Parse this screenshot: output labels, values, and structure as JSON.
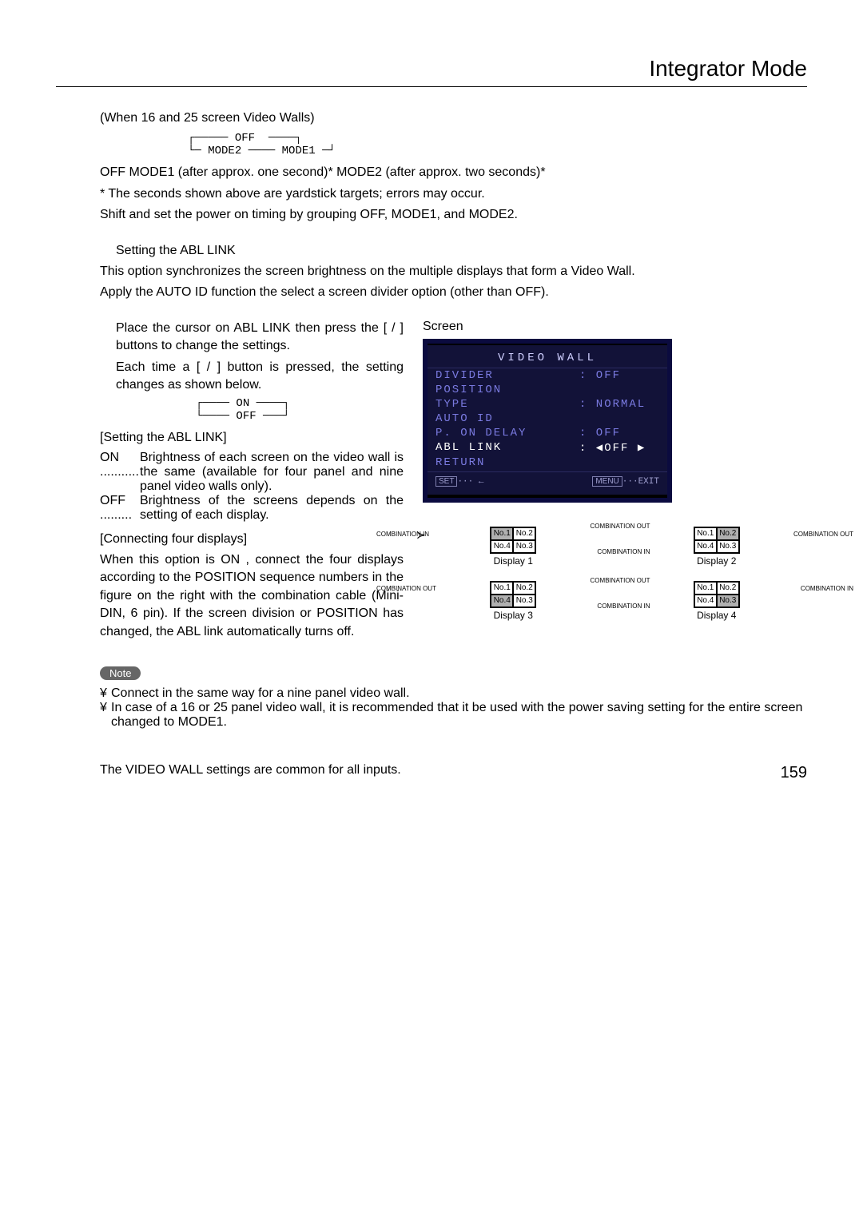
{
  "header": {
    "title": "Integrator Mode"
  },
  "intro": {
    "when_line": "(When 16 and 25 screen Video Walls)",
    "cycle_top": "OFF",
    "cycle_left": "MODE2",
    "cycle_right": "MODE1",
    "sequence": "OFF    MODE1 (after approx. one second)*    MODE2 (after approx. two seconds)*",
    "asterisk": "* The seconds shown above are yardstick targets; errors may occur.",
    "shift": "Shift and set the power on timing by grouping OFF, MODE1, and MODE2."
  },
  "abl": {
    "heading": "Setting the ABL LINK",
    "desc1": "This option synchronizes the screen brightness on the multiple displays that form a Video Wall.",
    "desc2": "Apply the AUTO ID function the select a screen divider option (other than OFF).",
    "step1": "Place the cursor on  ABL LINK  then press the [   /   ] buttons to change the settings.",
    "step2": "Each time a [    /   ] button is pressed, the setting changes as shown below.",
    "cycle_on": "ON",
    "cycle_off": "OFF",
    "setting_heading": "[Setting the ABL LINK]",
    "on_label": "ON ...........",
    "on_text": "Brightness of each screen on the video wall is the same (available for four panel and nine panel video walls only).",
    "off_label": "OFF .........",
    "off_text": "Brightness of the screens depends on the setting of each display.",
    "connect_heading": "[Connecting four displays]",
    "connect_text": "When this option is  ON , connect the four displays according to the POSITION sequence numbers in the figure on the right with the combination cable (Mini-DIN, 6 pin). If the screen division or POSITION has changed, the ABL link automatically turns off."
  },
  "screen": {
    "label": "Screen",
    "title": "VIDEO WALL",
    "rows": [
      {
        "lbl": "DIVIDER",
        "val": ":   OFF",
        "active": false
      },
      {
        "lbl": "POSITION",
        "val": "",
        "active": false
      },
      {
        "lbl": "TYPE",
        "val": ":   NORMAL",
        "active": false
      },
      {
        "lbl": "AUTO ID",
        "val": "",
        "active": false
      },
      {
        "lbl": "P. ON DELAY",
        "val": ":   OFF",
        "active": false
      },
      {
        "lbl": "ABL LINK",
        "val": ": ◀OFF ▶",
        "active": true
      },
      {
        "lbl": "RETURN",
        "val": "",
        "active": false
      }
    ],
    "bottom_left_tag": "SET",
    "bottom_left": "··· ←",
    "bottom_right_tag": "MENU",
    "bottom_right": "···EXIT"
  },
  "diagram": {
    "cells": [
      "No.1",
      "No.2",
      "No.4",
      "No.3"
    ],
    "displays": [
      {
        "label": "Display 1",
        "highlight": 0
      },
      {
        "label": "Display 2",
        "highlight": 1
      },
      {
        "label": "Display 3",
        "highlight": 2
      },
      {
        "label": "Display 4",
        "highlight": 3
      }
    ],
    "comb_in": "COMBINATION\nIN",
    "comb_out": "COMBINATION\nOUT"
  },
  "note": {
    "badge": "Note",
    "bullet_sym": "¥",
    "n1": "Connect in the same way for a nine panel video wall.",
    "n2": "In case of a 16 or 25 panel video wall, it is recommended that it be used with the power saving setting for the entire screen changed to MODE1."
  },
  "footer": {
    "common": "The  VIDEO WALL  settings are common for all inputs.",
    "page": "159"
  }
}
